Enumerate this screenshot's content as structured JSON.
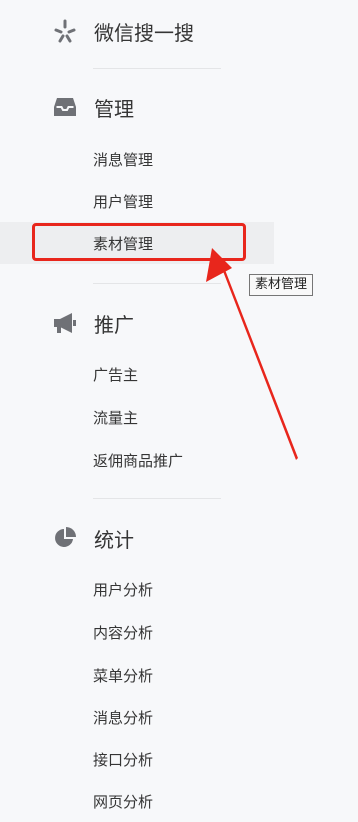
{
  "search": {
    "label": "微信搜一搜",
    "icon": "sparkle-icon"
  },
  "sections": [
    {
      "title": "管理",
      "icon": "inbox-icon",
      "items": [
        "消息管理",
        "用户管理",
        "素材管理"
      ]
    },
    {
      "title": "推广",
      "icon": "megaphone-icon",
      "items": [
        "广告主",
        "流量主",
        "返佣商品推广"
      ]
    },
    {
      "title": "统计",
      "icon": "pie-chart-icon",
      "items": [
        "用户分析",
        "内容分析",
        "菜单分析",
        "消息分析",
        "接口分析",
        "网页分析"
      ]
    }
  ],
  "active_item": "素材管理",
  "tooltip": "素材管理",
  "colors": {
    "annotation": "#e8261c",
    "icon": "#6f7176",
    "text": "#353535"
  }
}
